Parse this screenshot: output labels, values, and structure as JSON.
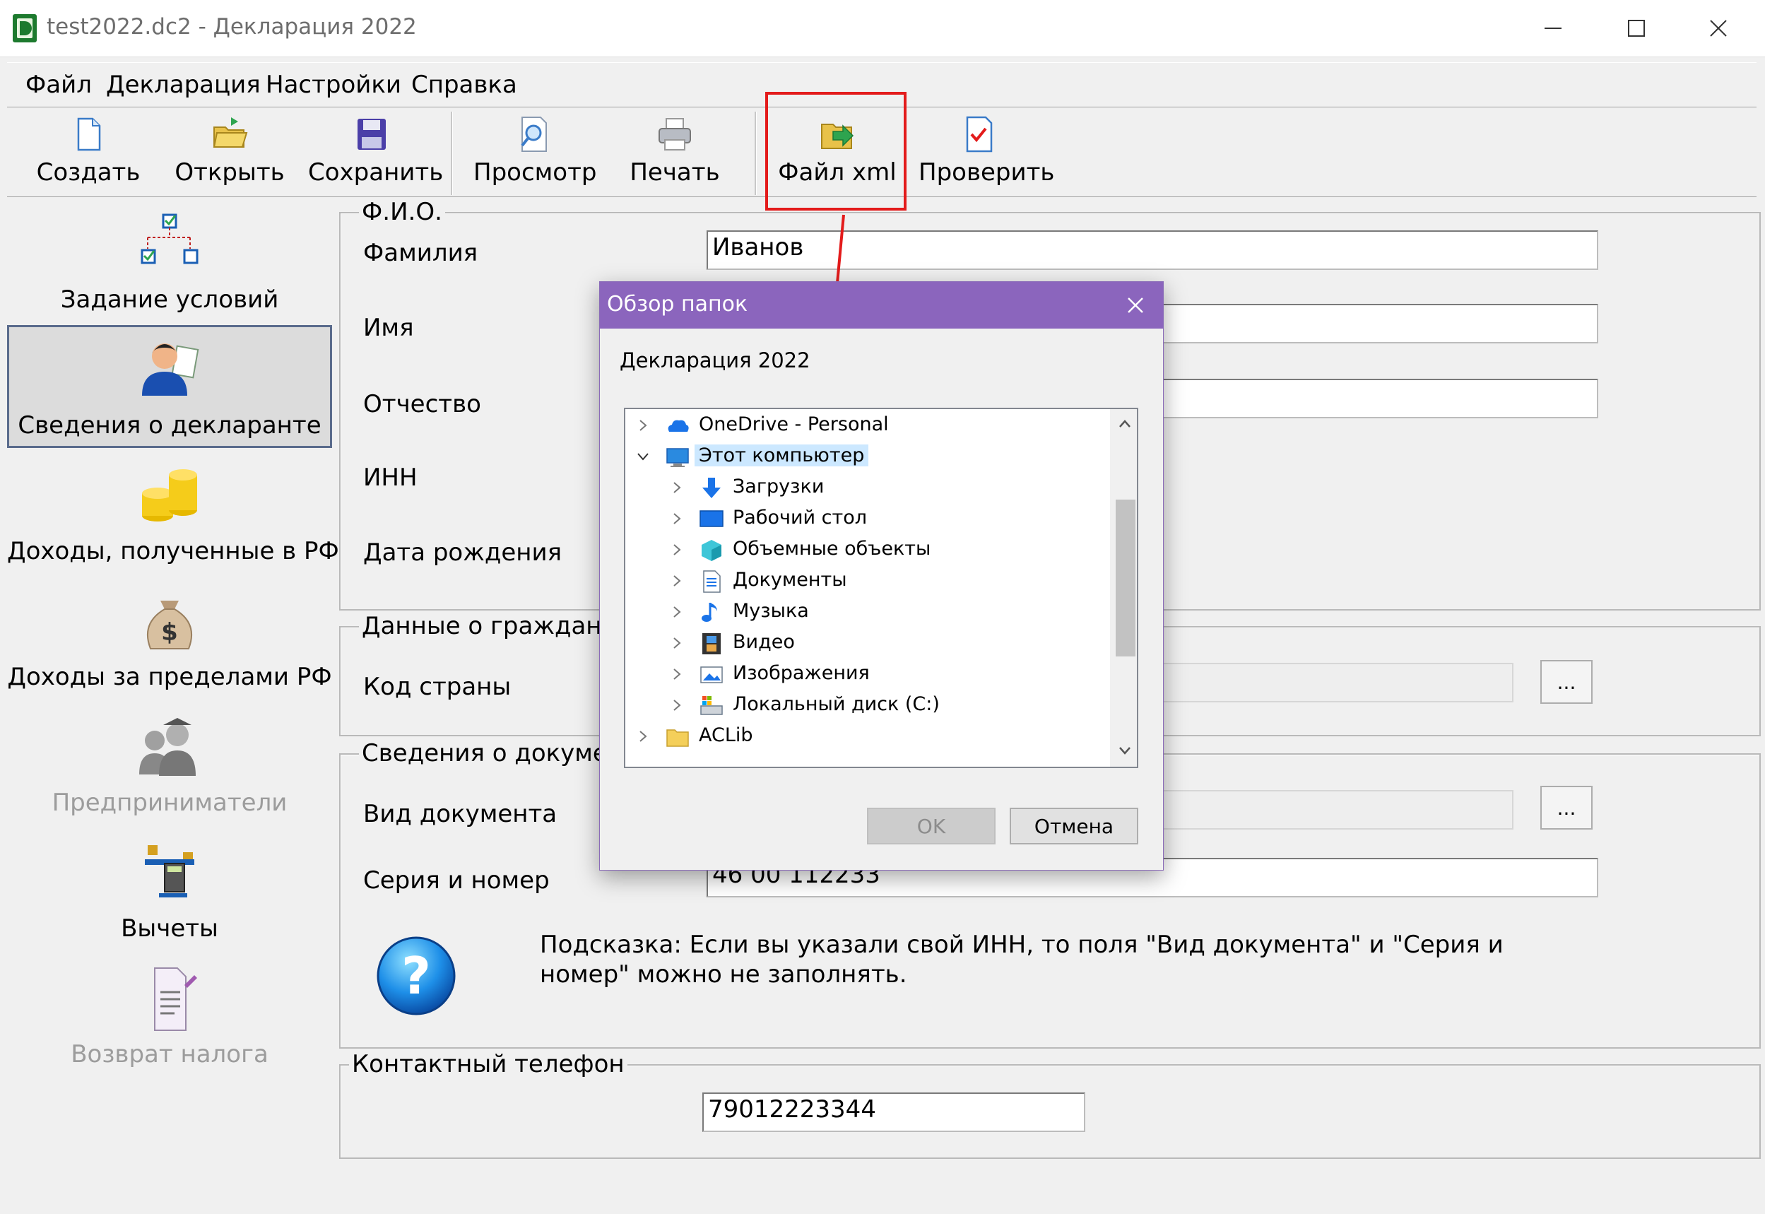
{
  "window": {
    "title": "test2022.dc2 - Декларация 2022"
  },
  "menu": [
    "Файл",
    "Декларация",
    "Настройки",
    "Справка"
  ],
  "toolbar": [
    {
      "label": "Создать",
      "icon": "new-file-icon"
    },
    {
      "label": "Открыть",
      "icon": "open-folder-icon"
    },
    {
      "label": "Сохранить",
      "icon": "save-disk-icon"
    },
    {
      "label": "Просмотр",
      "icon": "preview-icon"
    },
    {
      "label": "Печать",
      "icon": "printer-icon"
    },
    {
      "label": "Файл xml",
      "icon": "xml-export-icon"
    },
    {
      "label": "Проверить",
      "icon": "check-document-icon"
    }
  ],
  "nav": [
    {
      "label": "Задание условий",
      "icon": "conditions-tree-icon",
      "enabled": true
    },
    {
      "label": "Сведения о декларанте",
      "icon": "declarant-person-icon",
      "enabled": true,
      "selected": true
    },
    {
      "label": "Доходы, полученные в РФ",
      "icon": "coins-icon",
      "enabled": true
    },
    {
      "label": "Доходы за пределами РФ",
      "icon": "money-bag-icon",
      "enabled": true
    },
    {
      "label": "Предприниматели",
      "icon": "entrepreneurs-icon",
      "enabled": false
    },
    {
      "label": "Вычеты",
      "icon": "scales-calculator-icon",
      "enabled": true
    },
    {
      "label": "Возврат налога",
      "icon": "tax-return-doc-icon",
      "enabled": false
    }
  ],
  "fio": {
    "legend": "Ф.И.О.",
    "surname_label": "Фамилия",
    "surname_value": "Иванов",
    "name_label": "Имя",
    "name_value": "",
    "patronymic_label": "Отчество",
    "patronymic_value": "",
    "inn_label": "ИНН",
    "birthdate_label": "Дата рождения"
  },
  "citizenship": {
    "legend": "Данные о гражданст",
    "country_label": "Код страны",
    "browse_label": "..."
  },
  "document": {
    "legend": "Сведения о докумен",
    "type_label": "Вид документа",
    "browse_label": "...",
    "series_label": "Серия и номер",
    "series_value": "46 00 112233"
  },
  "hint": {
    "text": "Подсказка: Если вы указали свой ИНН, то поля \"Вид документа\" и \"Серия и номер\" можно не заполнять."
  },
  "contact": {
    "legend": "Контактный телефон",
    "phone_value": "79012223344"
  },
  "dialog": {
    "title": "Обзор папок",
    "description": "Декларация 2022",
    "tree": [
      {
        "label": "OneDrive - Personal",
        "icon": "onedrive-cloud-icon",
        "level": 0,
        "expanded": false
      },
      {
        "label": "Этот компьютер",
        "icon": "computer-icon",
        "level": 0,
        "expanded": true,
        "selected": true
      },
      {
        "label": "Загрузки",
        "icon": "downloads-arrow-icon",
        "level": 1,
        "expanded": false
      },
      {
        "label": "Рабочий стол",
        "icon": "desktop-icon",
        "level": 1,
        "expanded": false
      },
      {
        "label": "Объемные объекты",
        "icon": "3d-objects-icon",
        "level": 1,
        "expanded": false
      },
      {
        "label": "Документы",
        "icon": "documents-icon",
        "level": 1,
        "expanded": false
      },
      {
        "label": "Музыка",
        "icon": "music-note-icon",
        "level": 1,
        "expanded": false
      },
      {
        "label": "Видео",
        "icon": "video-film-icon",
        "level": 1,
        "expanded": false
      },
      {
        "label": "Изображения",
        "icon": "pictures-icon",
        "level": 1,
        "expanded": false
      },
      {
        "label": "Локальный диск (C:)",
        "icon": "local-disk-icon",
        "level": 1,
        "expanded": false
      },
      {
        "label": "ACLib",
        "icon": "folder-icon",
        "level": 0,
        "expanded": false
      }
    ],
    "ok_label": "OK",
    "cancel_label": "Отмена"
  },
  "colors": {
    "dialog_title_bg": "#8b65bd",
    "annotation_red": "#e31b1b",
    "tree_selection": "#cce8ff"
  }
}
